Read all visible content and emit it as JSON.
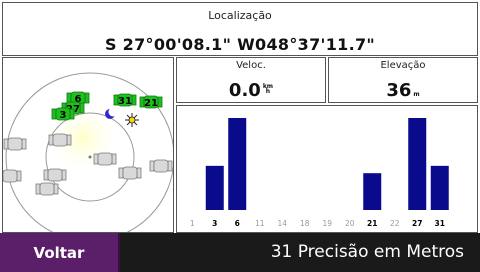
{
  "location": {
    "label": "Localização",
    "coords": "S 27°00'08.1\" W048°37'11.7\""
  },
  "speed": {
    "label": "Veloc.",
    "value": "0.0",
    "unit_top": "km",
    "unit_bottom": "h"
  },
  "elevation": {
    "label": "Elevação",
    "value": "36",
    "unit": "m"
  },
  "sky": {
    "satellites": [
      {
        "prn": "6",
        "locked": true
      },
      {
        "prn": "27",
        "locked": true
      },
      {
        "prn": "3",
        "locked": true
      },
      {
        "prn": "31",
        "locked": true
      },
      {
        "prn": "21",
        "locked": true
      },
      {
        "prn": "",
        "locked": false
      },
      {
        "prn": "",
        "locked": false
      },
      {
        "prn": "",
        "locked": false
      },
      {
        "prn": "",
        "locked": false
      },
      {
        "prn": "",
        "locked": false
      },
      {
        "prn": "",
        "locked": false
      },
      {
        "prn": "",
        "locked": false
      },
      {
        "prn": "",
        "locked": false
      }
    ],
    "moon_icon": "crescent-moon-icon",
    "sun_icon": "sun-icon"
  },
  "chart_data": {
    "type": "bar",
    "categories": [
      "1",
      "3",
      "6",
      "11",
      "14",
      "18",
      "19",
      "20",
      "21",
      "22",
      "27",
      "31"
    ],
    "values": [
      0,
      48,
      100,
      0,
      0,
      0,
      0,
      0,
      40,
      0,
      100,
      48
    ],
    "ylim": [
      0,
      100
    ],
    "color": "#0a0a8c",
    "highlight_labels": [
      "3",
      "6",
      "21",
      "27",
      "31"
    ]
  },
  "footer": {
    "back_label": "Voltar",
    "precision": "31 Precisão em Metros"
  },
  "colors": {
    "locked": "#1fbf1f",
    "unlocked": "#d9d9d9",
    "accent": "#5a1f68"
  }
}
